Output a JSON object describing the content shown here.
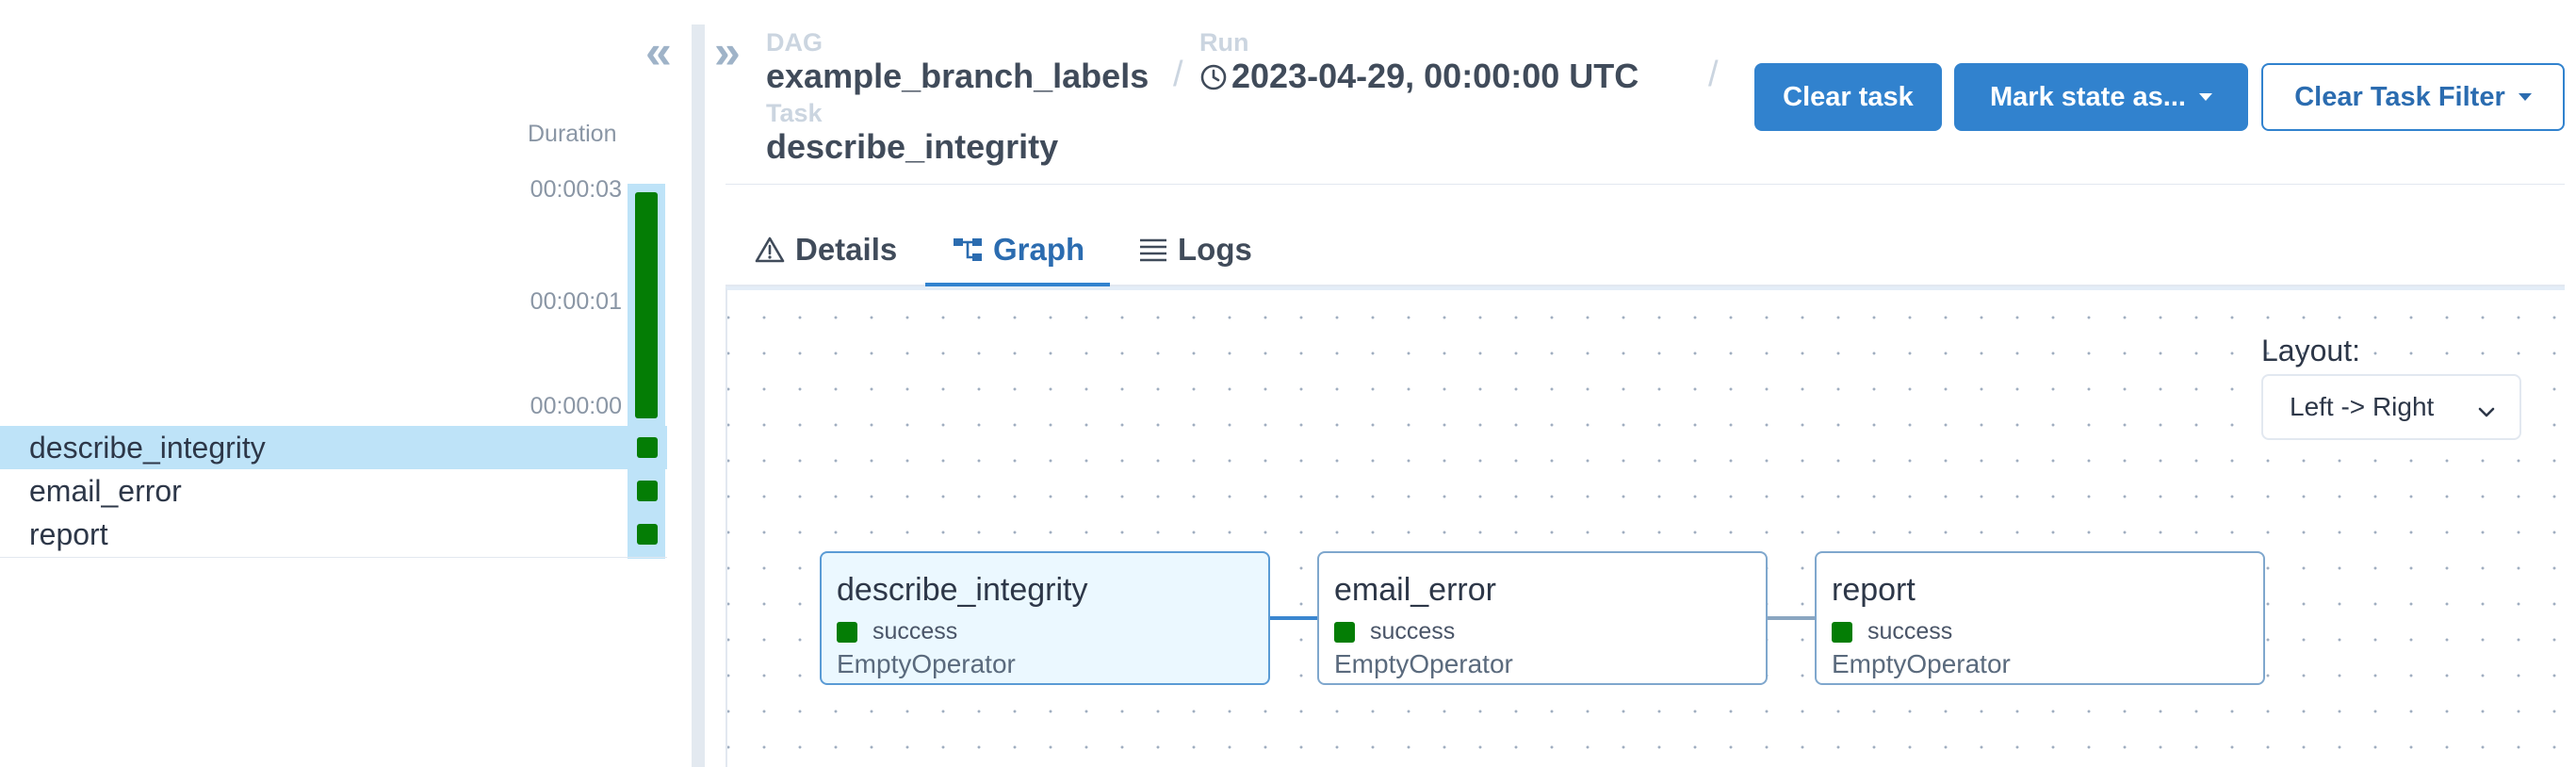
{
  "grid": {
    "collapse_icon": "double-chevron-left-icon",
    "duration_label": "Duration",
    "ticks": [
      "00:00:03",
      "00:00:01",
      "00:00:00"
    ],
    "run": {
      "status": "success",
      "status_color": "#047d05",
      "duration_fraction": 1.0
    },
    "tasks": [
      {
        "name": "describe_integrity",
        "status": "success",
        "selected": true
      },
      {
        "name": "email_error",
        "status": "success",
        "selected": false
      },
      {
        "name": "report",
        "status": "success",
        "selected": false
      }
    ]
  },
  "breadcrumb": {
    "expand_icon": "double-chevron-right-icon",
    "dag_label": "DAG",
    "dag_value": "example_branch_labels",
    "run_label": "Run",
    "run_icon": "clock-icon",
    "run_value": "2023-04-29, 00:00:00 UTC",
    "task_label": "Task",
    "task_value": "describe_integrity",
    "separator": "/"
  },
  "actions": {
    "clear_task": "Clear task",
    "mark_state": "Mark state as...",
    "clear_filter": "Clear Task Filter"
  },
  "tabs": [
    {
      "label": "Details",
      "icon": "warning-triangle-icon",
      "active": false
    },
    {
      "label": "Graph",
      "icon": "graph-icon",
      "active": true
    },
    {
      "label": "Logs",
      "icon": "list-icon",
      "active": false
    }
  ],
  "graph": {
    "layout_label": "Layout:",
    "layout_value": "Left -> Right",
    "nodes": [
      {
        "name": "describe_integrity",
        "status": "success",
        "operator": "EmptyOperator",
        "selected": true
      },
      {
        "name": "email_error",
        "status": "success",
        "operator": "EmptyOperator",
        "selected": false
      },
      {
        "name": "report",
        "status": "success",
        "operator": "EmptyOperator",
        "selected": false
      }
    ]
  },
  "colors": {
    "accent": "#3182ce",
    "success": "#047d05",
    "selected_bg": "#bee3f8"
  }
}
